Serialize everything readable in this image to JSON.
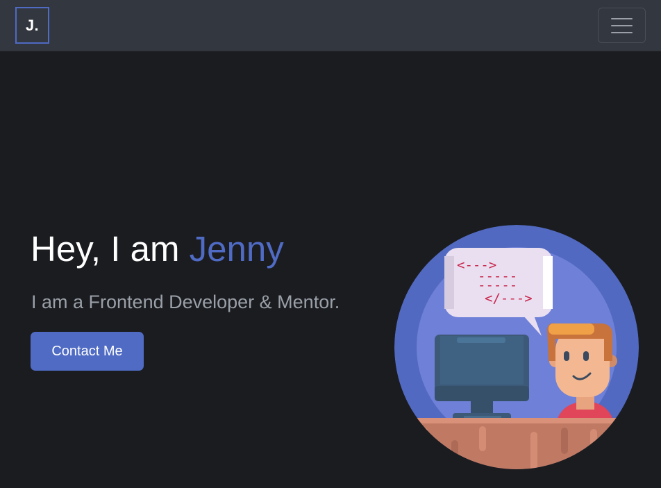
{
  "navbar": {
    "brand": "J.",
    "menu_icon": "hamburger-menu-icon"
  },
  "hero": {
    "greeting": "Hey, I am ",
    "name": "Jenny",
    "subtitle": "I am a Frontend Developer & Mentor.",
    "cta_label": "Contact Me"
  },
  "illustration": {
    "code_lines": [
      "<--->",
      "-----",
      "-----",
      "</--->"
    ]
  },
  "colors": {
    "accent": "#4f6bc4",
    "background": "#1b1c20",
    "navbar": "#33373f",
    "code_text": "#c9284e"
  }
}
